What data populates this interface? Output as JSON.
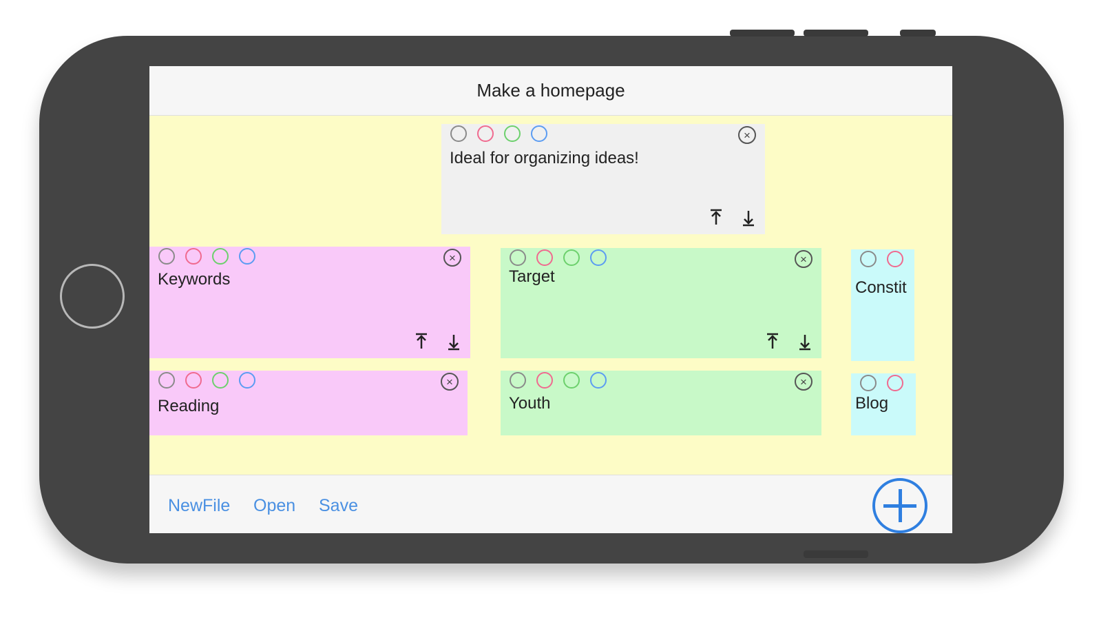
{
  "screen": {
    "title": "Make a homepage"
  },
  "colors": {
    "background": "#fdfcc6",
    "grey": "#f0f0f0",
    "pink": "#f9c9f9",
    "green": "#c8f9c8",
    "cyan": "#cafafa",
    "accent": "#2f7fe0"
  },
  "notes": [
    {
      "name": "note-ideal",
      "text": "Ideal for organizing ideas!",
      "color": "grey"
    },
    {
      "name": "note-keywords",
      "text": "Keywords",
      "color": "pink"
    },
    {
      "name": "note-target",
      "text": "Target",
      "color": "green"
    },
    {
      "name": "note-constit",
      "text": "Constit",
      "color": "cyan"
    },
    {
      "name": "note-reading",
      "text": "Reading",
      "color": "pink"
    },
    {
      "name": "note-youth",
      "text": "Youth",
      "color": "green"
    },
    {
      "name": "note-blog",
      "text": "Blog",
      "color": "cyan"
    }
  ],
  "toolbar": {
    "new_file_label": "NewFile",
    "open_label": "Open",
    "save_label": "Save",
    "add_icon": "plus-circle-icon"
  }
}
